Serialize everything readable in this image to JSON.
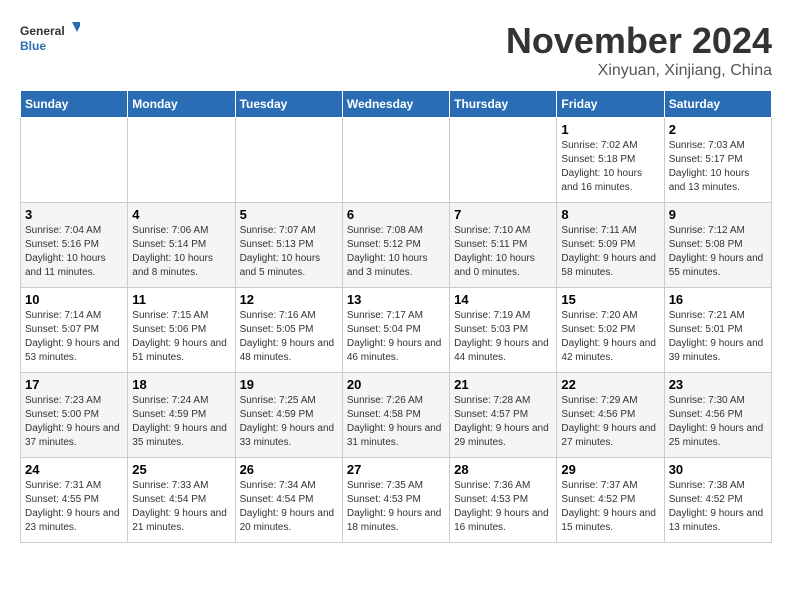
{
  "logo": {
    "line1": "General",
    "line2": "Blue"
  },
  "title": "November 2024",
  "location": "Xinyuan, Xinjiang, China",
  "weekdays": [
    "Sunday",
    "Monday",
    "Tuesday",
    "Wednesday",
    "Thursday",
    "Friday",
    "Saturday"
  ],
  "weeks": [
    [
      {
        "day": "",
        "info": ""
      },
      {
        "day": "",
        "info": ""
      },
      {
        "day": "",
        "info": ""
      },
      {
        "day": "",
        "info": ""
      },
      {
        "day": "",
        "info": ""
      },
      {
        "day": "1",
        "info": "Sunrise: 7:02 AM\nSunset: 5:18 PM\nDaylight: 10 hours and 16 minutes."
      },
      {
        "day": "2",
        "info": "Sunrise: 7:03 AM\nSunset: 5:17 PM\nDaylight: 10 hours and 13 minutes."
      }
    ],
    [
      {
        "day": "3",
        "info": "Sunrise: 7:04 AM\nSunset: 5:16 PM\nDaylight: 10 hours and 11 minutes."
      },
      {
        "day": "4",
        "info": "Sunrise: 7:06 AM\nSunset: 5:14 PM\nDaylight: 10 hours and 8 minutes."
      },
      {
        "day": "5",
        "info": "Sunrise: 7:07 AM\nSunset: 5:13 PM\nDaylight: 10 hours and 5 minutes."
      },
      {
        "day": "6",
        "info": "Sunrise: 7:08 AM\nSunset: 5:12 PM\nDaylight: 10 hours and 3 minutes."
      },
      {
        "day": "7",
        "info": "Sunrise: 7:10 AM\nSunset: 5:11 PM\nDaylight: 10 hours and 0 minutes."
      },
      {
        "day": "8",
        "info": "Sunrise: 7:11 AM\nSunset: 5:09 PM\nDaylight: 9 hours and 58 minutes."
      },
      {
        "day": "9",
        "info": "Sunrise: 7:12 AM\nSunset: 5:08 PM\nDaylight: 9 hours and 55 minutes."
      }
    ],
    [
      {
        "day": "10",
        "info": "Sunrise: 7:14 AM\nSunset: 5:07 PM\nDaylight: 9 hours and 53 minutes."
      },
      {
        "day": "11",
        "info": "Sunrise: 7:15 AM\nSunset: 5:06 PM\nDaylight: 9 hours and 51 minutes."
      },
      {
        "day": "12",
        "info": "Sunrise: 7:16 AM\nSunset: 5:05 PM\nDaylight: 9 hours and 48 minutes."
      },
      {
        "day": "13",
        "info": "Sunrise: 7:17 AM\nSunset: 5:04 PM\nDaylight: 9 hours and 46 minutes."
      },
      {
        "day": "14",
        "info": "Sunrise: 7:19 AM\nSunset: 5:03 PM\nDaylight: 9 hours and 44 minutes."
      },
      {
        "day": "15",
        "info": "Sunrise: 7:20 AM\nSunset: 5:02 PM\nDaylight: 9 hours and 42 minutes."
      },
      {
        "day": "16",
        "info": "Sunrise: 7:21 AM\nSunset: 5:01 PM\nDaylight: 9 hours and 39 minutes."
      }
    ],
    [
      {
        "day": "17",
        "info": "Sunrise: 7:23 AM\nSunset: 5:00 PM\nDaylight: 9 hours and 37 minutes."
      },
      {
        "day": "18",
        "info": "Sunrise: 7:24 AM\nSunset: 4:59 PM\nDaylight: 9 hours and 35 minutes."
      },
      {
        "day": "19",
        "info": "Sunrise: 7:25 AM\nSunset: 4:59 PM\nDaylight: 9 hours and 33 minutes."
      },
      {
        "day": "20",
        "info": "Sunrise: 7:26 AM\nSunset: 4:58 PM\nDaylight: 9 hours and 31 minutes."
      },
      {
        "day": "21",
        "info": "Sunrise: 7:28 AM\nSunset: 4:57 PM\nDaylight: 9 hours and 29 minutes."
      },
      {
        "day": "22",
        "info": "Sunrise: 7:29 AM\nSunset: 4:56 PM\nDaylight: 9 hours and 27 minutes."
      },
      {
        "day": "23",
        "info": "Sunrise: 7:30 AM\nSunset: 4:56 PM\nDaylight: 9 hours and 25 minutes."
      }
    ],
    [
      {
        "day": "24",
        "info": "Sunrise: 7:31 AM\nSunset: 4:55 PM\nDaylight: 9 hours and 23 minutes."
      },
      {
        "day": "25",
        "info": "Sunrise: 7:33 AM\nSunset: 4:54 PM\nDaylight: 9 hours and 21 minutes."
      },
      {
        "day": "26",
        "info": "Sunrise: 7:34 AM\nSunset: 4:54 PM\nDaylight: 9 hours and 20 minutes."
      },
      {
        "day": "27",
        "info": "Sunrise: 7:35 AM\nSunset: 4:53 PM\nDaylight: 9 hours and 18 minutes."
      },
      {
        "day": "28",
        "info": "Sunrise: 7:36 AM\nSunset: 4:53 PM\nDaylight: 9 hours and 16 minutes."
      },
      {
        "day": "29",
        "info": "Sunrise: 7:37 AM\nSunset: 4:52 PM\nDaylight: 9 hours and 15 minutes."
      },
      {
        "day": "30",
        "info": "Sunrise: 7:38 AM\nSunset: 4:52 PM\nDaylight: 9 hours and 13 minutes."
      }
    ]
  ]
}
